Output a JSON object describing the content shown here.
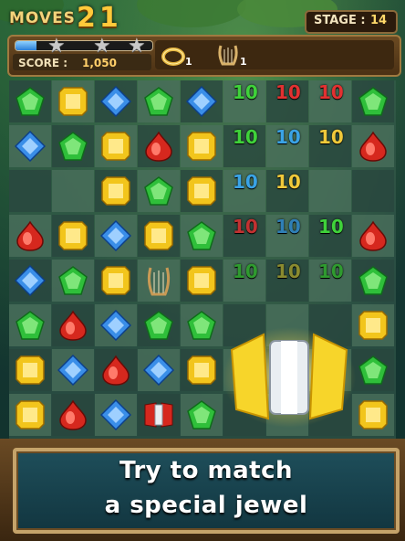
{
  "header": {
    "moves_label": "MOVES",
    "moves_value": "21",
    "stage_label": "STAGE :",
    "stage_value": "14"
  },
  "status": {
    "progress_fraction": 0.15,
    "stars_total": 3,
    "score_label": "SCORE :",
    "score_value": "1,050",
    "items": [
      {
        "icon": "ring-icon",
        "count": "1"
      },
      {
        "icon": "harp-icon",
        "count": "1"
      }
    ]
  },
  "board": {
    "rows": [
      [
        "green",
        "yellow",
        "blue",
        "green",
        "blue",
        "empty",
        "empty",
        "empty",
        "green"
      ],
      [
        "blue",
        "green",
        "yellow",
        "red",
        "yellow",
        "empty",
        "empty",
        "empty",
        "red"
      ],
      [
        "empty",
        "empty",
        "yellow",
        "green",
        "yellow",
        "empty",
        "empty",
        "empty",
        "empty"
      ],
      [
        "red",
        "yellow",
        "blue",
        "yellow",
        "green",
        "empty",
        "empty",
        "empty",
        "red"
      ],
      [
        "blue",
        "green",
        "yellow",
        "harp",
        "yellow",
        "empty",
        "empty",
        "empty",
        "green"
      ],
      [
        "green",
        "red",
        "blue",
        "green",
        "green",
        "empty",
        "empty",
        "empty",
        "yellow"
      ],
      [
        "yellow",
        "blue",
        "red",
        "blue",
        "yellow",
        "empty",
        "empty",
        "empty",
        "green"
      ],
      [
        "yellow",
        "red",
        "blue",
        "bomb",
        "green",
        "empty",
        "empty",
        "empty",
        "yellow"
      ]
    ],
    "score_pops": [
      {
        "text": "10",
        "color": "#3fd23a",
        "row": 0,
        "col": 5
      },
      {
        "text": "10",
        "color": "#e23131",
        "row": 0,
        "col": 6
      },
      {
        "text": "10",
        "color": "#e23131",
        "row": 0,
        "col": 7
      },
      {
        "text": "10",
        "color": "#3fd23a",
        "row": 1,
        "col": 5
      },
      {
        "text": "10",
        "color": "#3aa3e6",
        "row": 1,
        "col": 6
      },
      {
        "text": "10",
        "color": "#f0c93a",
        "row": 1,
        "col": 7
      },
      {
        "text": "10",
        "color": "#3aa3e6",
        "row": 2,
        "col": 5
      },
      {
        "text": "10",
        "color": "#f0c93a",
        "row": 2,
        "col": 6
      },
      {
        "text": "10",
        "color": "#c23131",
        "row": 3,
        "col": 5
      },
      {
        "text": "10",
        "color": "#2f7fb6",
        "row": 3,
        "col": 6
      },
      {
        "text": "10",
        "color": "#3fd23a",
        "row": 3,
        "col": 7
      },
      {
        "text": "10",
        "color": "#2f9a2f",
        "row": 4,
        "col": 5
      },
      {
        "text": "10",
        "color": "#8a8a2f",
        "row": 4,
        "col": 6
      },
      {
        "text": "10",
        "color": "#2f9a2f",
        "row": 4,
        "col": 7
      }
    ]
  },
  "tutorial": {
    "line1": "Try to match",
    "line2": "a special jewel"
  },
  "colors": {
    "green": "#2fbf3a",
    "blue": "#3a8ee8",
    "yellow": "#f2c51c",
    "red": "#d6281e",
    "gold": "#ffc93a"
  }
}
